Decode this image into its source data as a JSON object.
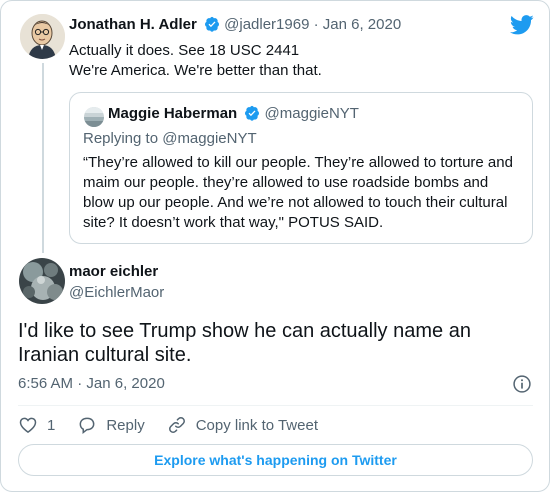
{
  "colors": {
    "accent": "#1d9bf0",
    "muted": "#536471",
    "text": "#0f1419",
    "border": "#cfd9de"
  },
  "parent": {
    "name": "Jonathan H. Adler",
    "handle": "@jadler1969",
    "separator": "·",
    "date": "Jan 6, 2020",
    "lines": [
      "Actually it does. See 18 USC 2441",
      "We're America. We're better than that."
    ],
    "avatar_icon": "avatar-illustration-icon",
    "verified_icon": "verified-badge-icon"
  },
  "quoted": {
    "name": "Maggie Haberman",
    "handle": "@maggieNYT",
    "replying_to": "Replying to @maggieNYT",
    "lines": [
      "“They’re allowed to kill our people. They’re allowed to torture and",
      "maim our people. they’re allowed to use roadside bombs and",
      "blow up our people. And we’re not allowed to touch their cultural",
      "site? It doesn’t work that way,\" POTUS SAID."
    ]
  },
  "main": {
    "name": "maor eichler",
    "handle": "@EichlerMaor",
    "lines": [
      "I'd like to see Trump show he can actually name an",
      "Iranian cultural site."
    ],
    "time": "6:56 AM",
    "separator": "·",
    "date": "Jan 6, 2020"
  },
  "actions": {
    "like_count": "1",
    "reply_label": "Reply",
    "copy_label": "Copy link to Tweet"
  },
  "explore_label": "Explore what's happening on Twitter",
  "icons": {
    "logo": "twitter-bird-icon",
    "info": "info-icon",
    "like": "heart-icon",
    "reply": "reply-bubble-icon",
    "link": "link-icon"
  }
}
